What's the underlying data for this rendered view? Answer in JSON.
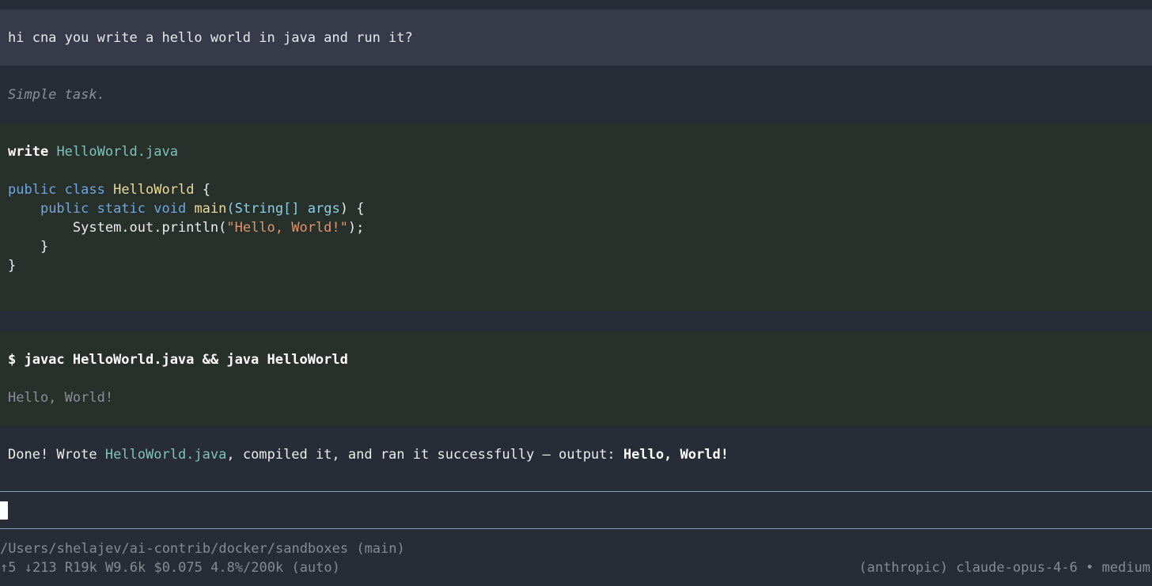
{
  "user_message": "hi cna you write a hello world in java and run it?",
  "thinking": "Simple task.",
  "write_tool": {
    "label": "write",
    "filename": "HelloWorld.java",
    "code": {
      "l1_kw": "public class",
      "l1_cls": "HelloWorld",
      "l1_rest": "{",
      "l2_kw": "public static void",
      "l2_fn": "main",
      "l2_paren": "(",
      "l2_type": "String[]",
      "l2_arg": "args",
      "l2_rest": ") {",
      "l3_call": "System.out.println(",
      "l3_str": "\"Hello, World!\"",
      "l3_end": ");",
      "l4": "}",
      "l5": "}"
    }
  },
  "bash_tool": {
    "command": "$ javac HelloWorld.java && java HelloWorld",
    "output": "Hello, World!"
  },
  "final_message": {
    "prefix": "Done! Wrote ",
    "filename": "HelloWorld.java",
    "middle": ", compiled it, and ran it successfully — output: ",
    "result": "Hello, World!"
  },
  "footer": {
    "path": "/Users/shelajev/ai-contrib/docker/sandboxes (main)",
    "stats": "↑5 ↓213 R19k W9.6k $0.075 4.8%/200k (auto)",
    "model": "(anthropic) claude-opus-4-6 • medium"
  },
  "colors": {
    "background": "#282c36",
    "user_bg": "#373a48",
    "tool_bg": "#28302b",
    "divider": "#7ea6b5"
  }
}
